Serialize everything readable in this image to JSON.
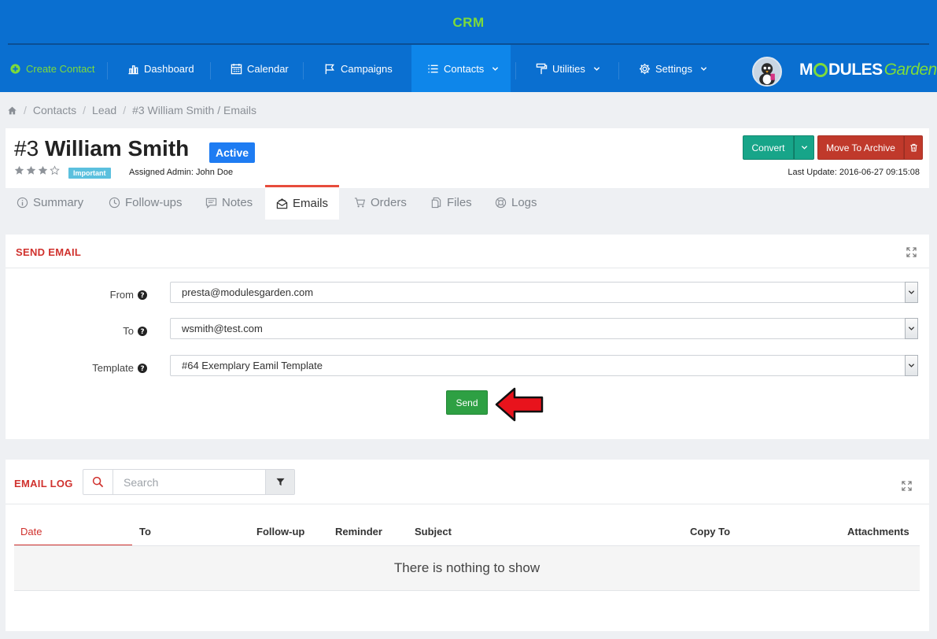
{
  "app": {
    "title": "CRM"
  },
  "nav": {
    "create_contact": "Create Contact",
    "dashboard": "Dashboard",
    "calendar": "Calendar",
    "campaigns": "Campaigns",
    "contacts": "Contacts",
    "utilities": "Utilities",
    "settings": "Settings"
  },
  "logo": {
    "m": "M",
    "dules": "DULES",
    "garden": "Garden"
  },
  "breadcrumb": {
    "items": [
      "Contacts",
      "Lead",
      "#3 William Smith / Emails"
    ]
  },
  "contact": {
    "number": "#3",
    "name": "William Smith",
    "status": "Active",
    "rating": 3,
    "rating_max": 4,
    "tag": "Important",
    "assigned": "Assigned Admin: John Doe",
    "last_update": "Last Update: 2016-06-27 09:15:08"
  },
  "actions": {
    "convert": "Convert",
    "archive": "Move To Archive"
  },
  "tabs": [
    "Summary",
    "Follow-ups",
    "Notes",
    "Emails",
    "Orders",
    "Files",
    "Logs"
  ],
  "active_tab": "Emails",
  "send_email": {
    "title": "SEND EMAIL",
    "from_label": "From",
    "from_value": "presta@modulesgarden.com",
    "to_label": "To",
    "to_value": "wsmith@test.com",
    "template_label": "Template",
    "template_value": "#64 Exemplary Eamil Template",
    "send_label": "Send"
  },
  "email_log": {
    "title": "EMAIL LOG",
    "search_placeholder": "Search",
    "columns": [
      "Date",
      "To",
      "Follow-up",
      "Reminder",
      "Subject",
      "Copy To",
      "Attachments"
    ],
    "empty": "There is nothing to show"
  },
  "colors": {
    "header": "#0a6fd0",
    "accent_green": "#7ddb3a",
    "convert": "#17a589",
    "archive": "#c0392b",
    "send": "#2ea043",
    "panel_title": "#d0312d"
  }
}
